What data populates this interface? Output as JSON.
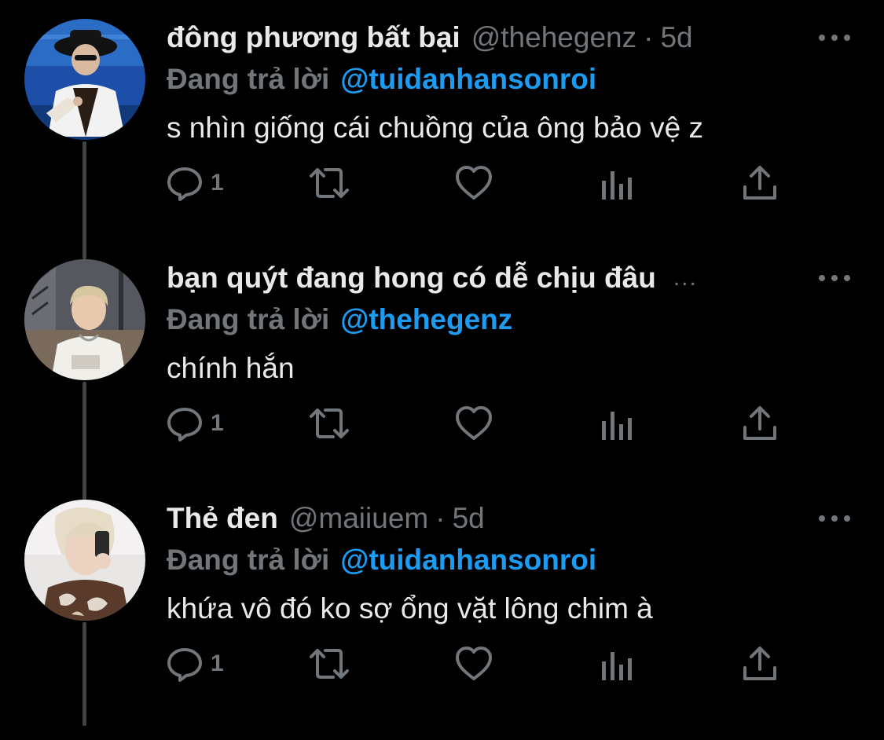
{
  "colors": {
    "background": "#000000",
    "text": "#e7e9ea",
    "muted": "#71767b",
    "accent": "#1d9bf0",
    "thread_line": "#3f4448"
  },
  "tweets": [
    {
      "name": "đông phương bất bại",
      "handle": "@thehegenz",
      "separator": "·",
      "time": "5d",
      "reply_label": "Đang trả lời",
      "reply_to": "@tuidanhansonroi",
      "text": "s nhìn giống cái chuồng của ông bảo vệ z",
      "reply_count": "1",
      "avatar_icon": "profile-photo"
    },
    {
      "name": "bạn quýt đang hong có dễ chịu đâu",
      "name_overflow": "...",
      "reply_label": "Đang trả lời",
      "reply_to": "@thehegenz",
      "text": "chính hắn",
      "reply_count": "1",
      "avatar_icon": "profile-photo"
    },
    {
      "name": "Thẻ đen",
      "handle": "@maiiuem",
      "separator": "·",
      "time": "5d",
      "reply_label": "Đang trả lời",
      "reply_to": "@tuidanhansonroi",
      "text": "khứa vô đó ko sợ ổng vặt lông chim à",
      "reply_count": "1",
      "avatar_icon": "profile-photo"
    }
  ],
  "action_icons": [
    "reply-icon",
    "retweet-icon",
    "like-icon",
    "analytics-icon",
    "share-icon"
  ]
}
